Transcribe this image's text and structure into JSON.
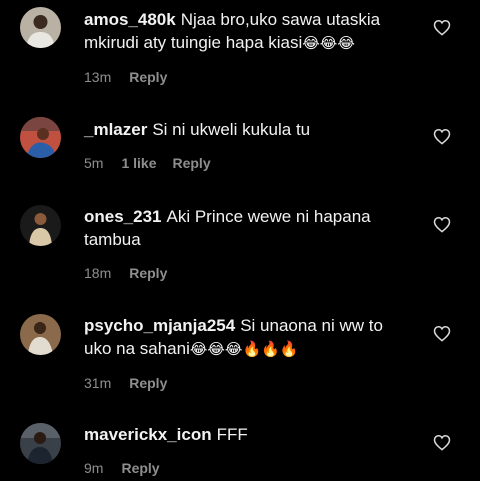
{
  "comments": [
    {
      "username": "amos_480k",
      "text": "Njaa bro,uko sawa utaskia mkirudi aty tuingie hapa kiasi",
      "emojis": "😂😂😂",
      "time": "13m",
      "likes": "",
      "reply": "Reply",
      "avatar_icon": "avatar-person-white-shirt"
    },
    {
      "username": "_mlazer",
      "text": "Si ni ukweli kukula tu",
      "emojis": "",
      "time": "5m",
      "likes": "1 like",
      "reply": "Reply",
      "avatar_icon": "avatar-person-red-background"
    },
    {
      "username": "ones_231",
      "text": "Aki Prince wewe ni hapana tambua",
      "emojis": "",
      "time": "18m",
      "likes": "",
      "reply": "Reply",
      "avatar_icon": "avatar-person-dark-background"
    },
    {
      "username": "psycho_mjanja254",
      "text": "Si unaona ni ww to uko na sahani",
      "emojis": "😂😂😂🔥🔥🔥",
      "time": "31m",
      "likes": "",
      "reply": "Reply",
      "avatar_icon": "avatar-person-brown-background"
    },
    {
      "username": "maverickx_icon",
      "text": "FFF",
      "emojis": "",
      "time": "9m",
      "likes": "",
      "reply": "Reply",
      "avatar_icon": "avatar-person-group-photo"
    }
  ],
  "colors": {
    "background": "#000000",
    "text": "#f2f2f2",
    "meta": "#8e8e8e"
  },
  "icons": {
    "like": "heart-outline-icon"
  }
}
